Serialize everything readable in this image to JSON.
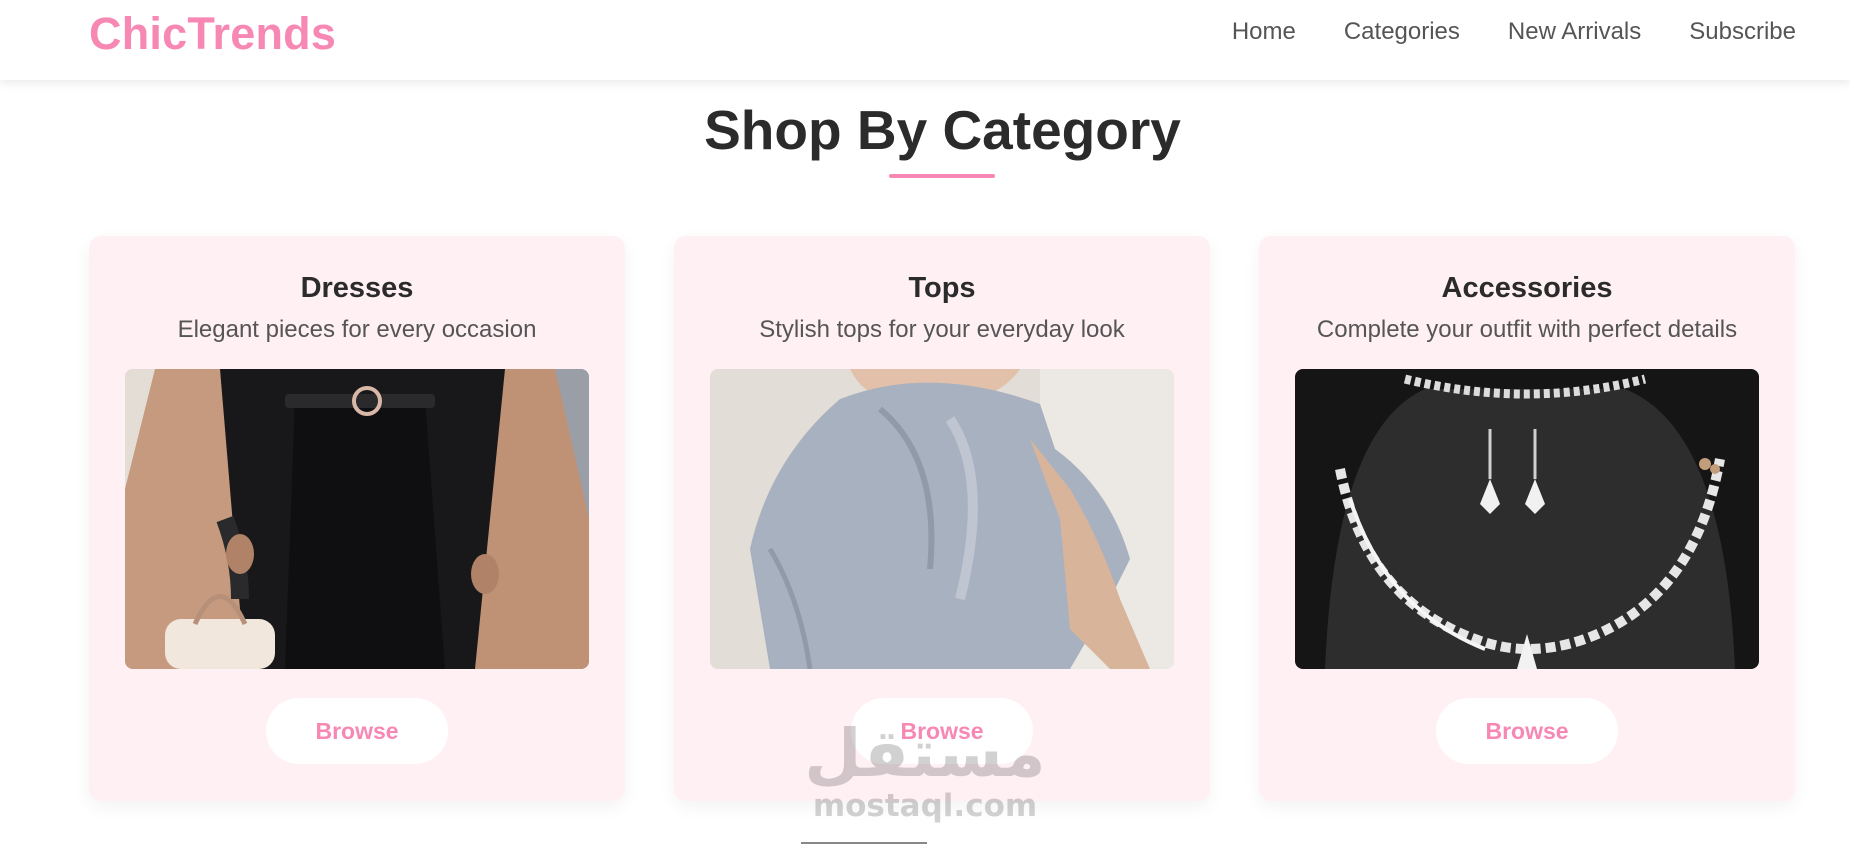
{
  "header": {
    "brand": "ChicTrends",
    "nav": [
      {
        "label": "Home"
      },
      {
        "label": "Categories"
      },
      {
        "label": "New Arrivals"
      },
      {
        "label": "Subscribe"
      }
    ]
  },
  "section": {
    "title": "Shop By Category"
  },
  "categories": [
    {
      "title": "Dresses",
      "description": "Elegant pieces for every occasion",
      "button": "Browse"
    },
    {
      "title": "Tops",
      "description": "Stylish tops for your everyday look",
      "button": "Browse"
    },
    {
      "title": "Accessories",
      "description": "Complete your outfit with perfect details",
      "button": "Browse"
    }
  ],
  "watermark": {
    "arabic": "مستقل",
    "latin": "mostaql.com"
  },
  "colors": {
    "accent": "#f788b4",
    "card_background": "#fff0f4",
    "heading": "#2b2b2b",
    "text": "#555555"
  }
}
